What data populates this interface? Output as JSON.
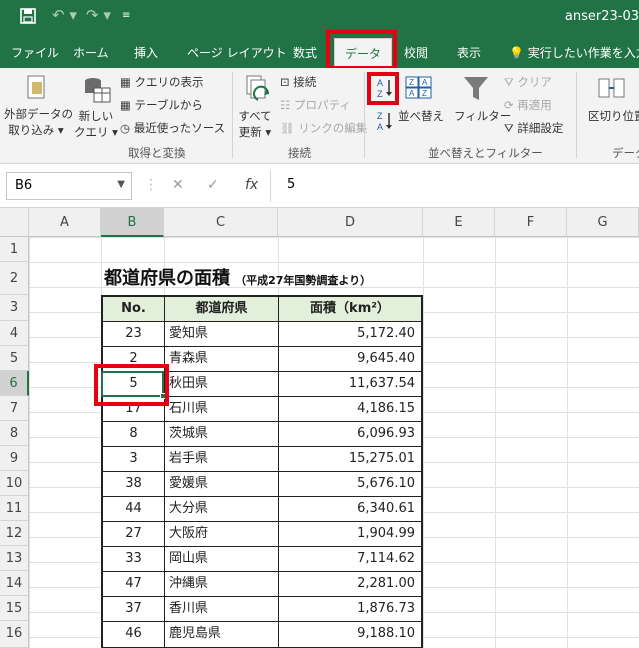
{
  "window": {
    "doc_title": "anser23-03"
  },
  "ribbon_tabs": [
    "ファイル",
    "ホーム",
    "挿入",
    "ページ レイアウト",
    "数式",
    "データ",
    "校閲",
    "表示"
  ],
  "tell_me": "実行したい作業を入力し",
  "ribbon": {
    "ext_data": [
      "外部データの",
      "取り込み ▾"
    ],
    "new_query": [
      "新しい",
      "クエリ ▾"
    ],
    "show_queries": "クエリの表示",
    "from_table": "テーブルから",
    "recent_sources": "最近使ったソース",
    "refresh_all": [
      "すべて",
      "更新 ▾"
    ],
    "connections": "接続",
    "properties": "プロパティ",
    "edit_links": "リンクの編集",
    "sort_az": "A↓Z",
    "sort": "並べ替え",
    "filter": "フィルター",
    "clear": "クリア",
    "reapply": "再適用",
    "advanced": "詳細設定",
    "text_to_columns": "区切り位置",
    "groups": {
      "get_transform": "取得と変換",
      "connections": "接続",
      "sort_filter": "並べ替えとフィルター",
      "data_tools": "データ"
    }
  },
  "formula_bar": {
    "name_box": "B6",
    "value": "5"
  },
  "columns": [
    "A",
    "B",
    "C",
    "D",
    "E",
    "F",
    "G"
  ],
  "rows": [
    "1",
    "2",
    "3",
    "4",
    "5",
    "6",
    "7",
    "8",
    "9",
    "10",
    "11",
    "12",
    "13",
    "14",
    "15",
    "16"
  ],
  "sheet": {
    "title": "都道府県の面積",
    "subtitle": "（平成27年国勢調査より）",
    "headers": {
      "no": "No.",
      "pref": "都道府県",
      "area": "面積（km²）"
    },
    "table": [
      {
        "no": "23",
        "pref": "愛知県",
        "area": "5,172.40"
      },
      {
        "no": "2",
        "pref": "青森県",
        "area": "9,645.40"
      },
      {
        "no": "5",
        "pref": "秋田県",
        "area": "11,637.54"
      },
      {
        "no": "17",
        "pref": "石川県",
        "area": "4,186.15"
      },
      {
        "no": "8",
        "pref": "茨城県",
        "area": "6,096.93"
      },
      {
        "no": "3",
        "pref": "岩手県",
        "area": "15,275.01"
      },
      {
        "no": "38",
        "pref": "愛媛県",
        "area": "5,676.10"
      },
      {
        "no": "44",
        "pref": "大分県",
        "area": "6,340.61"
      },
      {
        "no": "27",
        "pref": "大阪府",
        "area": "1,904.99"
      },
      {
        "no": "33",
        "pref": "岡山県",
        "area": "7,114.62"
      },
      {
        "no": "47",
        "pref": "沖縄県",
        "area": "2,281.00"
      },
      {
        "no": "37",
        "pref": "香川県",
        "area": "1,876.73"
      },
      {
        "no": "46",
        "pref": "鹿児島県",
        "area": "9,188.10"
      }
    ]
  },
  "colors": {
    "excel_green": "#217346",
    "highlight_red": "#e60012",
    "header_fill": "#e2efda"
  }
}
